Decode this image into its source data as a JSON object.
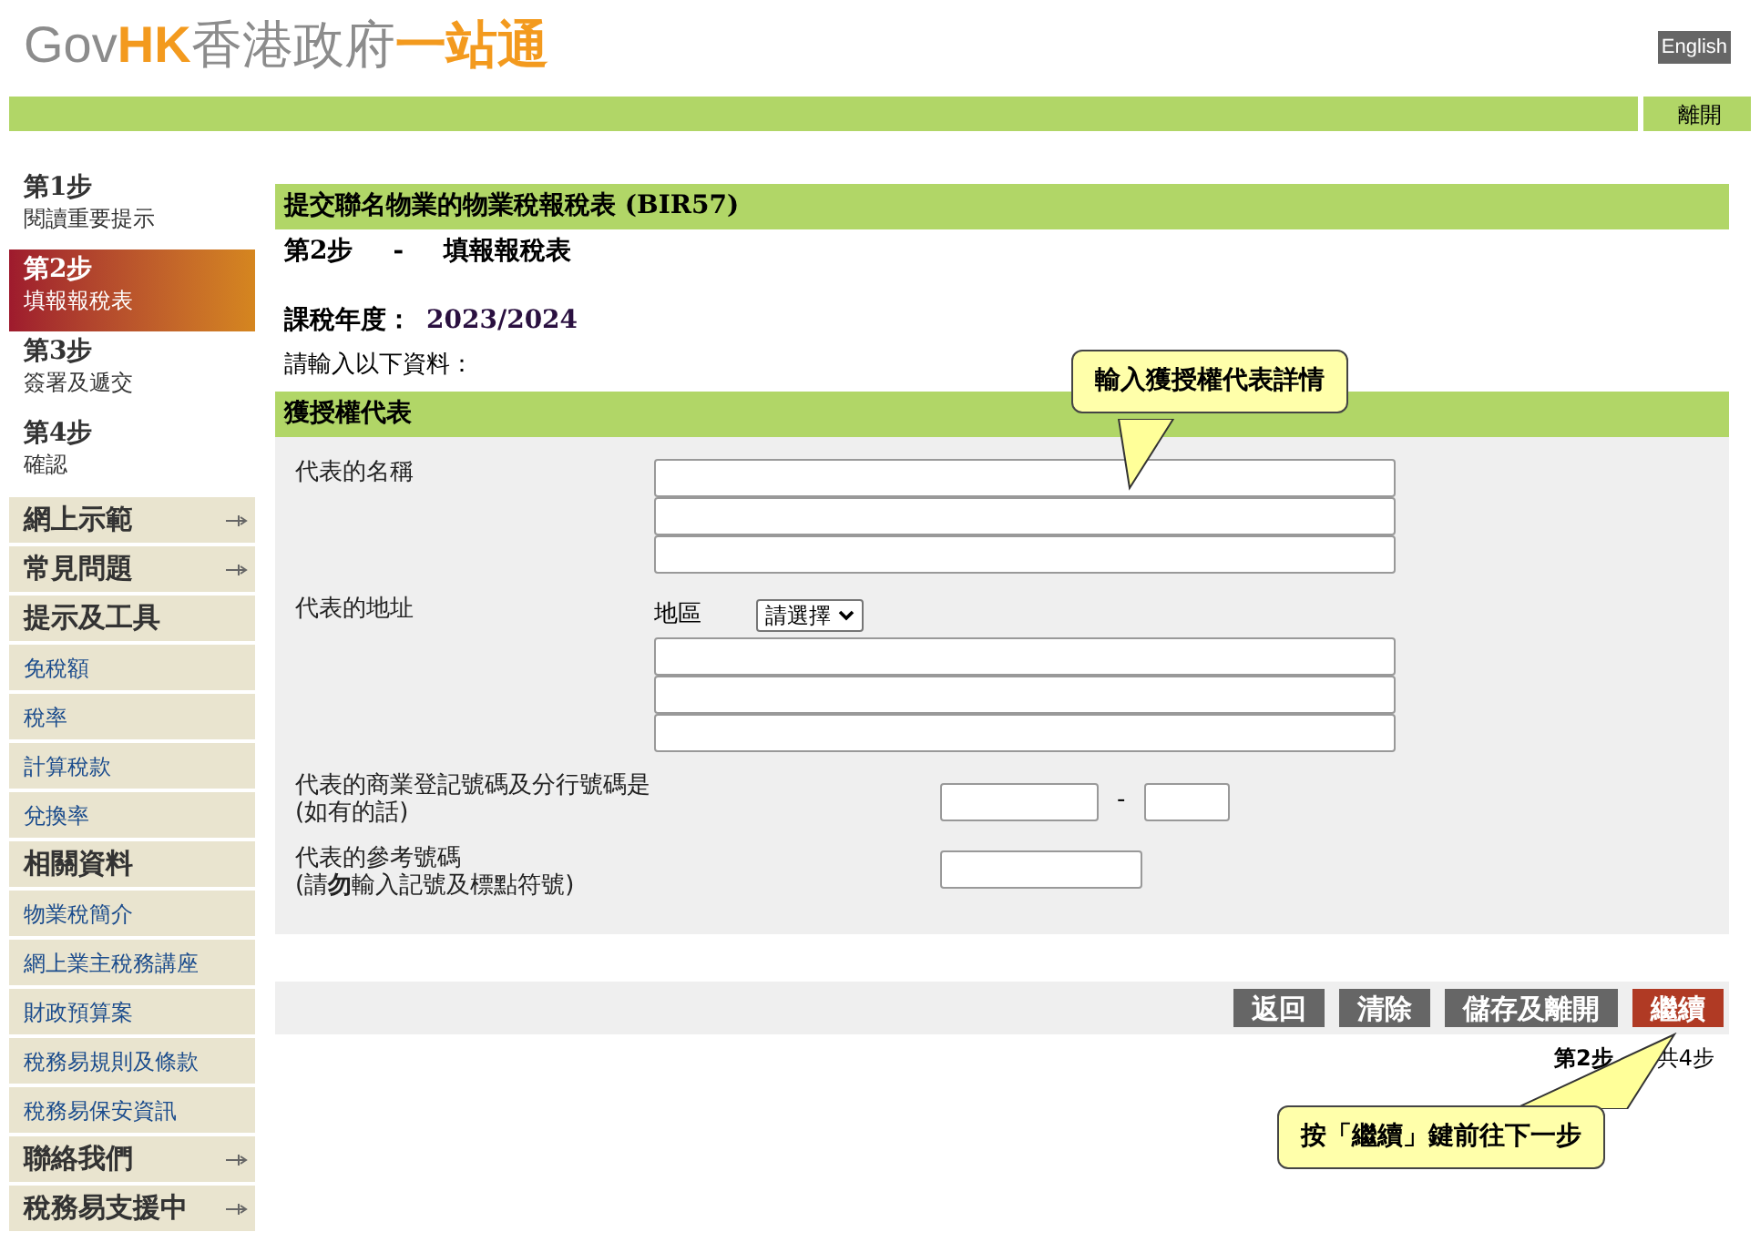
{
  "logo": {
    "parts": [
      {
        "text": "Gov",
        "color": "#8c8c8c"
      },
      {
        "text": "HK",
        "color": "#f39a1e"
      },
      {
        "text": "香港政府",
        "color": "#8c8c8c"
      },
      {
        "text": "一站通",
        "color": "#f39a1e"
      }
    ]
  },
  "language_button": "English",
  "exit_button": "離開",
  "steps": [
    {
      "title": "第1步",
      "subtitle": "閱讀重要提示",
      "selected": false
    },
    {
      "title": "第2步",
      "subtitle": "填報報稅表",
      "selected": true
    },
    {
      "title": "第3步",
      "subtitle": "簽署及遞交",
      "selected": false
    },
    {
      "title": "第4步",
      "subtitle": "確認",
      "selected": false
    }
  ],
  "menu": [
    {
      "label": "網上示範",
      "kind": "heading",
      "expandable": true
    },
    {
      "label": "常見問題",
      "kind": "heading",
      "expandable": true
    },
    {
      "label": "提示及工具",
      "kind": "heading",
      "expandable": false
    },
    {
      "label": "免稅額",
      "kind": "link"
    },
    {
      "label": "稅率",
      "kind": "link"
    },
    {
      "label": "計算稅款",
      "kind": "link"
    },
    {
      "label": "兌換率",
      "kind": "link"
    },
    {
      "label": "相關資料",
      "kind": "heading",
      "expandable": false
    },
    {
      "label": "物業稅簡介",
      "kind": "link"
    },
    {
      "label": "網上業主稅務講座",
      "kind": "link"
    },
    {
      "label": "財政預算案",
      "kind": "link"
    },
    {
      "label": "稅務易規則及條款",
      "kind": "link"
    },
    {
      "label": "稅務易保安資訊",
      "kind": "link"
    },
    {
      "label": "聯絡我們",
      "kind": "heading",
      "expandable": true
    },
    {
      "label": "稅務易支援中",
      "kind": "heading",
      "expandable": true
    }
  ],
  "page_title": "提交聯名物業的物業稅報稅表 (BIR57)",
  "step_heading": {
    "step": "第2步",
    "separator": "-",
    "name": "填報報稅表"
  },
  "tax_year": {
    "label": "課稅年度：",
    "value": "2023/2024"
  },
  "prompt": "請輸入以下資料：",
  "section_title": "獲授權代表",
  "form_rows": [
    {
      "kind": "multiline",
      "label": [
        "代表的名稱"
      ]
    },
    {
      "kind": "address",
      "label": [
        "代表的地址"
      ],
      "region_label": "地區",
      "region_value": "請選擇"
    },
    {
      "kind": "split",
      "label": [
        "代表的商業登記號碼及分行號碼是",
        "(如有的話)"
      ],
      "separator": "-"
    },
    {
      "kind": "single",
      "label": [
        "代表的參考號碼",
        "(請**勿**輸入記號及標點符號)"
      ]
    }
  ],
  "buttons": [
    {
      "label": "返回",
      "kind": "secondary"
    },
    {
      "label": "清除",
      "kind": "secondary"
    },
    {
      "label": "儲存及離開",
      "kind": "secondary"
    },
    {
      "label": "繼續",
      "kind": "primary"
    }
  ],
  "progress": {
    "current": "第2步",
    "total": "共4步"
  },
  "callouts": [
    {
      "text": "輸入獲授權代表詳情"
    },
    {
      "text": "按「繼續」鍵前往下一步"
    }
  ]
}
